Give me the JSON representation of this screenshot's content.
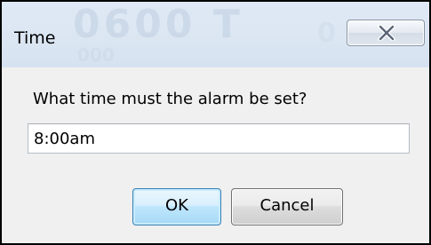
{
  "dialog": {
    "title": "Time",
    "close_icon": "close-icon",
    "prompt": "What time must the alarm be set?",
    "input_value": "8:00am",
    "ok_label": "OK",
    "cancel_label": "Cancel",
    "background_ghost_text": [
      "0600 T",
      "000",
      "0"
    ]
  },
  "colors": {
    "titlebar": "#dce7f3",
    "body": "#f0f0f0",
    "ok_button": "#bee6fd",
    "border": "#000000"
  }
}
